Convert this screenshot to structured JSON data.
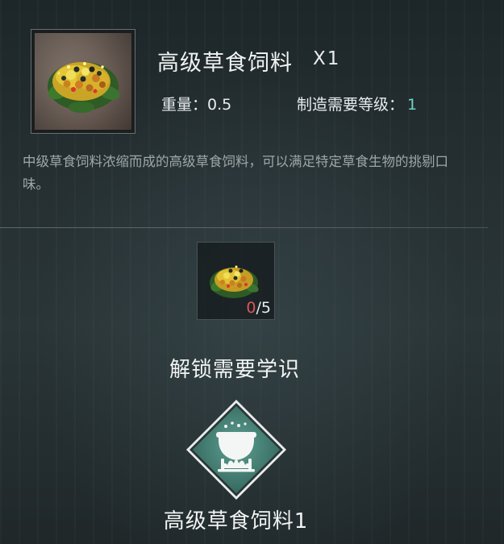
{
  "item": {
    "name": "高级草食饲料",
    "quantity": "X1",
    "icon": "herbivore-feed-icon",
    "weight_label": "重量：",
    "weight_value": "0.5",
    "craft_level_label": "制造需要等级：",
    "craft_level_value": "1",
    "description": "中级草食饲料浓缩而成的高级草食饲料，可以满足特定草食生物的挑剔口味。"
  },
  "ingredients": [
    {
      "icon": "herbivore-feed-icon",
      "have": "0",
      "separator": "/",
      "need": "5"
    }
  ],
  "unlock": {
    "title": "解锁需要学识",
    "knowledge_icon": "cauldron-icon",
    "knowledge_name": "高级草食饲料1"
  },
  "colors": {
    "accent_teal": "#6fd3c2",
    "missing_red": "#e0555a",
    "diamond_fill": "#4f8c80"
  }
}
